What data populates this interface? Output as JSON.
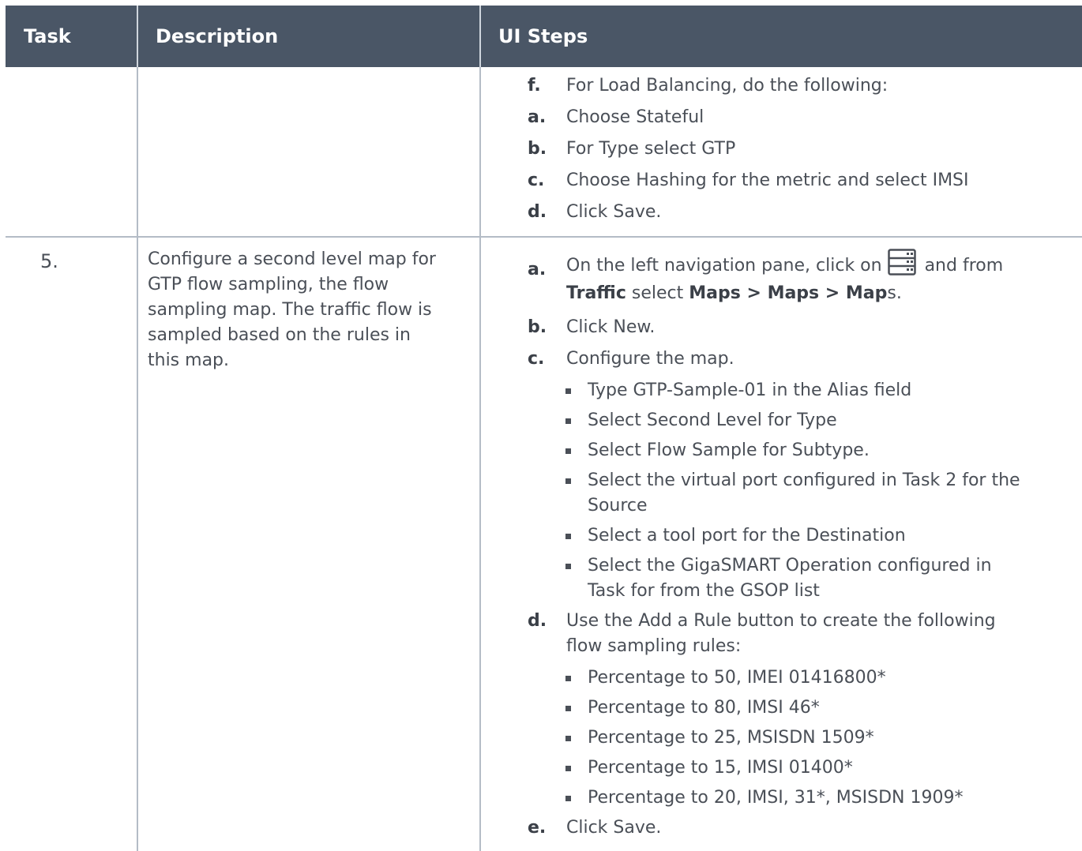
{
  "header": {
    "task": "Task",
    "description": "Description",
    "ui_steps": "UI Steps"
  },
  "row1": {
    "steps": [
      {
        "letter": "f.",
        "text": "For Load Balancing, do the following:"
      },
      {
        "letter": "a.",
        "text": "Choose Stateful"
      },
      {
        "letter": "b.",
        "text": "For Type select GTP"
      },
      {
        "letter": "c.",
        "text": "Choose Hashing for the metric and select IMSI"
      },
      {
        "letter": "d.",
        "text": "Click Save."
      }
    ]
  },
  "row2": {
    "task_number": "5.",
    "description_lines": [
      "Configure a second level map for",
      "GTP flow sampling, the flow",
      "sampling map. The traffic flow is",
      "sampled based on the rules in",
      "this map."
    ],
    "step_a": {
      "letter": "a.",
      "text_before_icon": "On the left navigation pane, click on",
      "text_after_icon": "and from",
      "line2_bold1": "Traffic",
      "line2_text1": " select ",
      "line2_bold2": "Maps > Maps > Map",
      "line2_text2": "s.",
      "icon": "navigation-menu-icon"
    },
    "step_b": {
      "letter": "b.",
      "text": "Click New."
    },
    "step_c": {
      "letter": "c.",
      "text": "Configure the map."
    },
    "step_c_bullets": [
      [
        "Type GTP-Sample-01 in the Alias field"
      ],
      [
        "Select Second Level for Type"
      ],
      [
        "Select Flow Sample for Subtype."
      ],
      [
        "Select the virtual port configured in Task 2 for the",
        "Source"
      ],
      [
        "Select a tool port for the Destination"
      ],
      [
        "Select the GigaSMART Operation configured in",
        "Task for from the GSOP list"
      ]
    ],
    "step_d": {
      "letter": "d.",
      "lines": [
        "Use the Add a Rule button to create the following",
        "flow sampling rules:"
      ]
    },
    "step_d_bullets": [
      "Percentage to 50, IMEI 01416800*",
      "Percentage to 80, IMSI 46*",
      "Percentage to 25, MSISDN 1509*",
      "Percentage to 15, IMSI 01400*",
      "Percentage to 20, IMSI, 31*, MSISDN 1909*"
    ],
    "step_e": {
      "letter": "e.",
      "text": "Click Save."
    }
  },
  "colors": {
    "header_bg": "#4a5666",
    "header_text": "#ffffff",
    "body_text": "#4a4f57",
    "grid_line": "#b4bcc6"
  }
}
